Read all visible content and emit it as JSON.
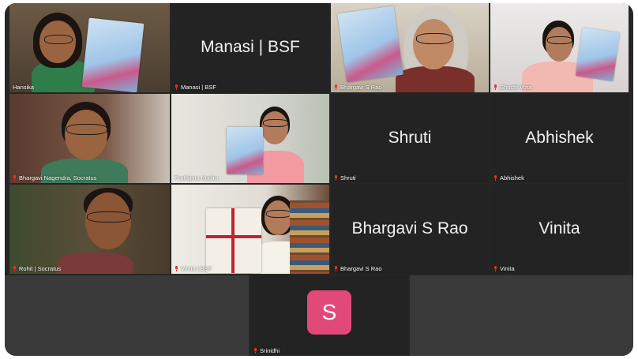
{
  "participants": [
    {
      "name": "Hansika",
      "type": "video"
    },
    {
      "name": "Manasi | BSF",
      "display": "Manasi | BSF",
      "type": "name"
    },
    {
      "name": "Bhargavi S Rao",
      "type": "video"
    },
    {
      "name": "Shuchi Vora",
      "type": "video"
    },
    {
      "name": "Bhargavi Nagendra, Socratus",
      "type": "video"
    },
    {
      "name": "Prathijma Kodira",
      "type": "video"
    },
    {
      "name": "Shruti",
      "display": "Shruti",
      "type": "name"
    },
    {
      "name": "Abhishek",
      "display": "Abhishek",
      "type": "name"
    },
    {
      "name": "Rohit | Socratus",
      "type": "video"
    },
    {
      "name": "Vinita | BSF",
      "type": "video"
    },
    {
      "name": "Bhargavi S Rao",
      "display": "Bhargavi S Rao",
      "type": "name"
    },
    {
      "name": "Vinita",
      "display": "Vinita",
      "type": "name"
    },
    {
      "name": "Srinidhi",
      "avatar_letter": "S",
      "avatar_color": "#e14a78",
      "type": "avatar"
    }
  ],
  "colors": {
    "background": "#262626",
    "tile": "#232323",
    "muted_mic": "#e0352b"
  },
  "icons": {
    "muted": "mic-muted-icon"
  }
}
